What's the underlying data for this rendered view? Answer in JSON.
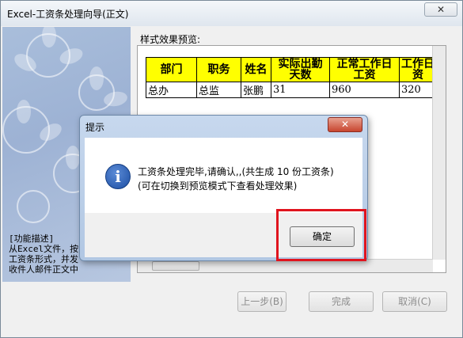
{
  "window": {
    "title": "Excel-工资条处理向导(正文)",
    "close_label": "✕"
  },
  "side_panel": {
    "description": "[功能描述]\n从Excel文件，按\n工资条形式，并发\n收件人邮件正文中"
  },
  "preview": {
    "label": "样式效果预览:",
    "headers": [
      "部门",
      "职务",
      "姓名",
      "实际出勤\n天数",
      "正常工作日\n工资",
      "工作日\n资"
    ],
    "rows": [
      [
        "总办",
        "总监",
        "张鹏",
        "31",
        "960",
        "320"
      ]
    ],
    "header_color": "#ffff00"
  },
  "buttons": {
    "prev": "上一步(B)",
    "finish": "完成",
    "cancel": "取消(C)"
  },
  "dialog": {
    "title": "提示",
    "close_label": "✕",
    "icon": "info-icon",
    "line1": "工资条处理完毕,请确认,,(共生成 10  份工资条)",
    "line2": "(可在切换到预览模式下查看处理效果)",
    "ok_label": "确定"
  },
  "highlight_color": "#e0141e"
}
